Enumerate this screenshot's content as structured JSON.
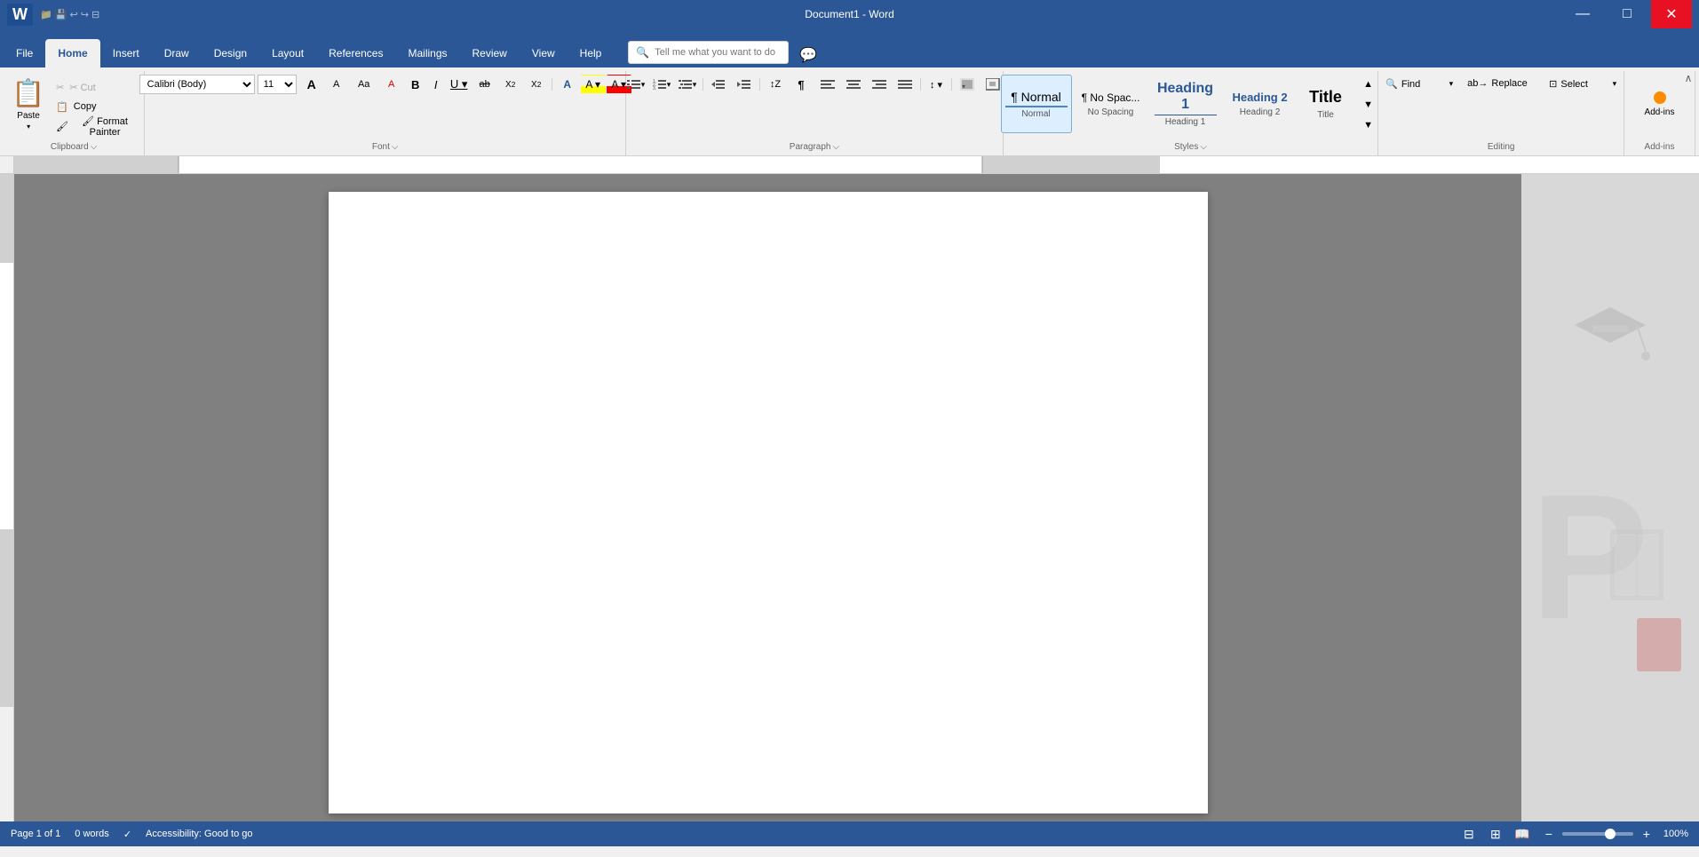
{
  "titleBar": {
    "title": "Document1 - Word",
    "minimizeLabel": "—",
    "maximizeLabel": "□",
    "closeLabel": "✕"
  },
  "ribbonTabs": {
    "tabs": [
      {
        "id": "file",
        "label": "File"
      },
      {
        "id": "home",
        "label": "Home",
        "active": true
      },
      {
        "id": "insert",
        "label": "Insert"
      },
      {
        "id": "draw",
        "label": "Draw"
      },
      {
        "id": "design",
        "label": "Design"
      },
      {
        "id": "layout",
        "label": "Layout"
      },
      {
        "id": "references",
        "label": "References"
      },
      {
        "id": "mailings",
        "label": "Mailings"
      },
      {
        "id": "review",
        "label": "Review"
      },
      {
        "id": "view",
        "label": "View"
      },
      {
        "id": "help",
        "label": "Help"
      }
    ]
  },
  "tellMe": {
    "placeholder": "Tell me what you want to do"
  },
  "clipboard": {
    "pasteLabel": "Paste",
    "cutLabel": "✂ Cut",
    "copyLabel": "📋 Copy",
    "formatPainterLabel": "🖌 Format Painter",
    "groupLabel": "Clipboard",
    "expandIcon": "⌵"
  },
  "font": {
    "fontName": "Calibri (Body)",
    "fontSize": "11",
    "growLabel": "A",
    "shrinkLabel": "A",
    "caseLabel": "Aa",
    "clearLabel": "A",
    "boldLabel": "B",
    "italicLabel": "I",
    "underlineLabel": "U",
    "strikeLabel": "ab",
    "subscriptLabel": "X₂",
    "superscriptLabel": "X²",
    "textEffectsLabel": "A",
    "highlightLabel": "A",
    "fontColorLabel": "A",
    "groupLabel": "Font",
    "expandIcon": "⌵"
  },
  "paragraph": {
    "bulletsLabel": "≡",
    "numberingLabel": "≡",
    "multiLabel": "≡",
    "decreaseIndentLabel": "⇐",
    "increaseIndentLabel": "⇒",
    "sortLabel": "↕",
    "showHideLabel": "¶",
    "alignLeftLabel": "≡",
    "centerLabel": "≡",
    "alignRightLabel": "≡",
    "justifyLabel": "≡",
    "lineSpacingLabel": "↕",
    "shadingLabel": "▦",
    "borderLabel": "▦",
    "groupLabel": "Paragraph",
    "expandIcon": "⌵"
  },
  "styles": {
    "items": [
      {
        "id": "normal",
        "preview": "¶ Normal",
        "label": "Normal",
        "active": true
      },
      {
        "id": "no-spacing",
        "preview": "¶ No Spac...",
        "label": "No Spacing",
        "active": false
      },
      {
        "id": "heading1",
        "preview": "Heading 1",
        "label": "Heading 1",
        "active": false
      },
      {
        "id": "heading2",
        "preview": "Heading 2",
        "label": "Heading 2",
        "active": false
      },
      {
        "id": "title",
        "preview": "Title",
        "label": "Title",
        "active": false
      }
    ],
    "scrollUpLabel": "▲",
    "scrollDownLabel": "▼",
    "expandLabel": "▼",
    "groupLabel": "Styles",
    "expandIcon": "⌵"
  },
  "editing": {
    "findLabel": "Find",
    "replaceLabel": "Replace",
    "selectLabel": "Select",
    "groupLabel": "Editing",
    "dropIcon": "▾"
  },
  "addins": {
    "label": "Add-ins",
    "groupLabel": "Add-ins",
    "collapseLabel": "∧"
  },
  "statusBar": {
    "pageInfo": "Page 1 of 1",
    "wordCount": "0 words",
    "spellCheck": "Accessibility: Good to go",
    "zoomLevel": "100%",
    "zoomMinus": "−",
    "zoomPlus": "+"
  },
  "document": {
    "content": ""
  }
}
